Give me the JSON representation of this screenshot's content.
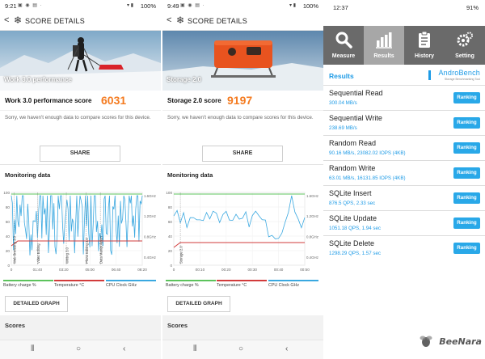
{
  "panel1": {
    "status": {
      "time": "9:21",
      "battery": "100%"
    },
    "header_title": "SCORE DETAILS",
    "hero_label": "Work 3.0 performance",
    "score_name": "Work 3.0 performance score",
    "score_value": "6031",
    "sorry_text": "Sorry, we haven't enough data to compare scores for this device.",
    "share_label": "SHARE",
    "monitoring_title": "Monitoring data",
    "y_left_ticks": [
      "100",
      "80",
      "60",
      "40",
      "20",
      "0"
    ],
    "y_right_ticks": [
      "1.6GHz",
      "1.2GHz",
      "0.8GHz",
      "0.4GHz"
    ],
    "x_ticks": [
      "0",
      "01:40",
      "03:20",
      "05:00",
      "06:40",
      "08:20"
    ],
    "markers": [
      "Web Browsing 3.0",
      "Video Editing",
      "Writing 3.0",
      "Photo Editing 3.0",
      "Data Manipulation"
    ],
    "legend": [
      "Battery charge %",
      "Temperature °C",
      "CPU Clock GHz"
    ],
    "detailed_label": "DETAILED GRAPH",
    "scores_label": "Scores"
  },
  "panel2": {
    "status": {
      "time": "9:49",
      "battery": "100%"
    },
    "header_title": "SCORE DETAILS",
    "hero_label": "Storage 2.0",
    "score_name": "Storage 2.0 score",
    "score_value": "9197",
    "sorry_text": "Sorry, we haven't enough data to compare scores for this device.",
    "share_label": "SHARE",
    "monitoring_title": "Monitoring data",
    "y_left_ticks": [
      "100",
      "80",
      "60",
      "40",
      "20",
      "0"
    ],
    "y_right_ticks": [
      "1.6GHz",
      "1.2GHz",
      "0.8GHz",
      "0.4GHz"
    ],
    "x_ticks": [
      "0",
      "00:10",
      "00:20",
      "00:30",
      "00:40",
      "00:50"
    ],
    "markers": [
      "Storage 2.0"
    ],
    "legend": [
      "Battery charge %",
      "Temperature °C",
      "CPU Clock GHz"
    ],
    "detailed_label": "DETAILED GRAPH",
    "scores_label": "Scores"
  },
  "androbench": {
    "status": {
      "time": "12:37",
      "battery": "91%"
    },
    "tabs": [
      {
        "label": "Measure",
        "icon": "magnifier-icon"
      },
      {
        "label": "Results",
        "icon": "bar-chart-icon"
      },
      {
        "label": "History",
        "icon": "clipboard-icon"
      },
      {
        "label": "Setting",
        "icon": "gears-icon"
      }
    ],
    "results_title": "Results",
    "logo_text": "AndroBench",
    "logo_sub": "Storage Benchmarking Tool",
    "ranking_label": "Ranking",
    "rows": [
      {
        "name": "Sequential Read",
        "value": "300.04 MB/s"
      },
      {
        "name": "Sequential Write",
        "value": "238.69 MB/s"
      },
      {
        "name": "Random Read",
        "value": "90.16 MB/s, 23082.02 IOPS (4KB)"
      },
      {
        "name": "Random Write",
        "value": "63.01 MB/s, 16131.85 IOPS (4KB)"
      },
      {
        "name": "SQLite Insert",
        "value": "876.5 QPS, 2.33 sec"
      },
      {
        "name": "SQLite Update",
        "value": "1051.18 QPS, 1.94 sec"
      },
      {
        "name": "SQLite Delete",
        "value": "1298.29 QPS, 1.57 sec"
      }
    ],
    "watermark": "BeeNara"
  },
  "colors": {
    "score_orange": "#f47b20",
    "cpu_line": "#3aa8e0",
    "battery_line": "#5cc35c",
    "temp_line": "#d23b3b",
    "andro_blue": "#1e9be6",
    "tab_bar": "#6a6a6a"
  }
}
